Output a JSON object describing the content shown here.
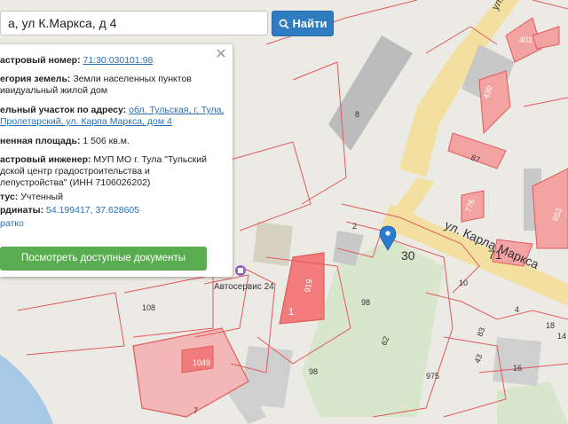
{
  "search": {
    "value": "а, ул К.Маркса, д 4",
    "button_label": "Найти"
  },
  "panel": {
    "cadastral_number": {
      "label": "астровый номер:",
      "value": "71:30:030101:98"
    },
    "land_category": {
      "label": "егория земель:",
      "line1": "Земли населенных пунктов",
      "line2": "ивидуальный жилой дом"
    },
    "address": {
      "label": "ельный участок по адресу:",
      "line1": "обл. Тульская, г. Тула,",
      "line2": "Пролетарский, ул. Карла Маркса, дом 4"
    },
    "area": {
      "label": "ненная площадь:",
      "value": "1 506 кв.м."
    },
    "engineer": {
      "label": "астровый инженер:",
      "line1": "МУП МО г. Тула \"Тульский",
      "line2": "дской центр градостроительства и",
      "line3": "лепустройства\" (ИНН 7106026202)"
    },
    "status": {
      "label": "тус:",
      "value": "Учтенный"
    },
    "coordinates": {
      "label": "рдинаты:",
      "value": "54.199417, 37.628605"
    },
    "short_link": "ратко",
    "docs_button": "Посмотреть доступные документы"
  },
  "map": {
    "street_name": "ул. Карла Маркса",
    "street_name_top": "ул.",
    "poi_label": "Автосервис 24",
    "lot_numbers": [
      "8",
      "439",
      "87",
      "402",
      "776",
      "853",
      "2",
      "30",
      "1",
      "919",
      "108",
      "98",
      "62",
      "975",
      "10",
      "4",
      "18",
      "16",
      "43",
      "83",
      "98",
      "1049",
      "7",
      "71",
      "14"
    ],
    "marker_color": "#2b7bd1",
    "parcel_color": "#e25a5a",
    "parcel_fill": "#f4a3a3"
  }
}
